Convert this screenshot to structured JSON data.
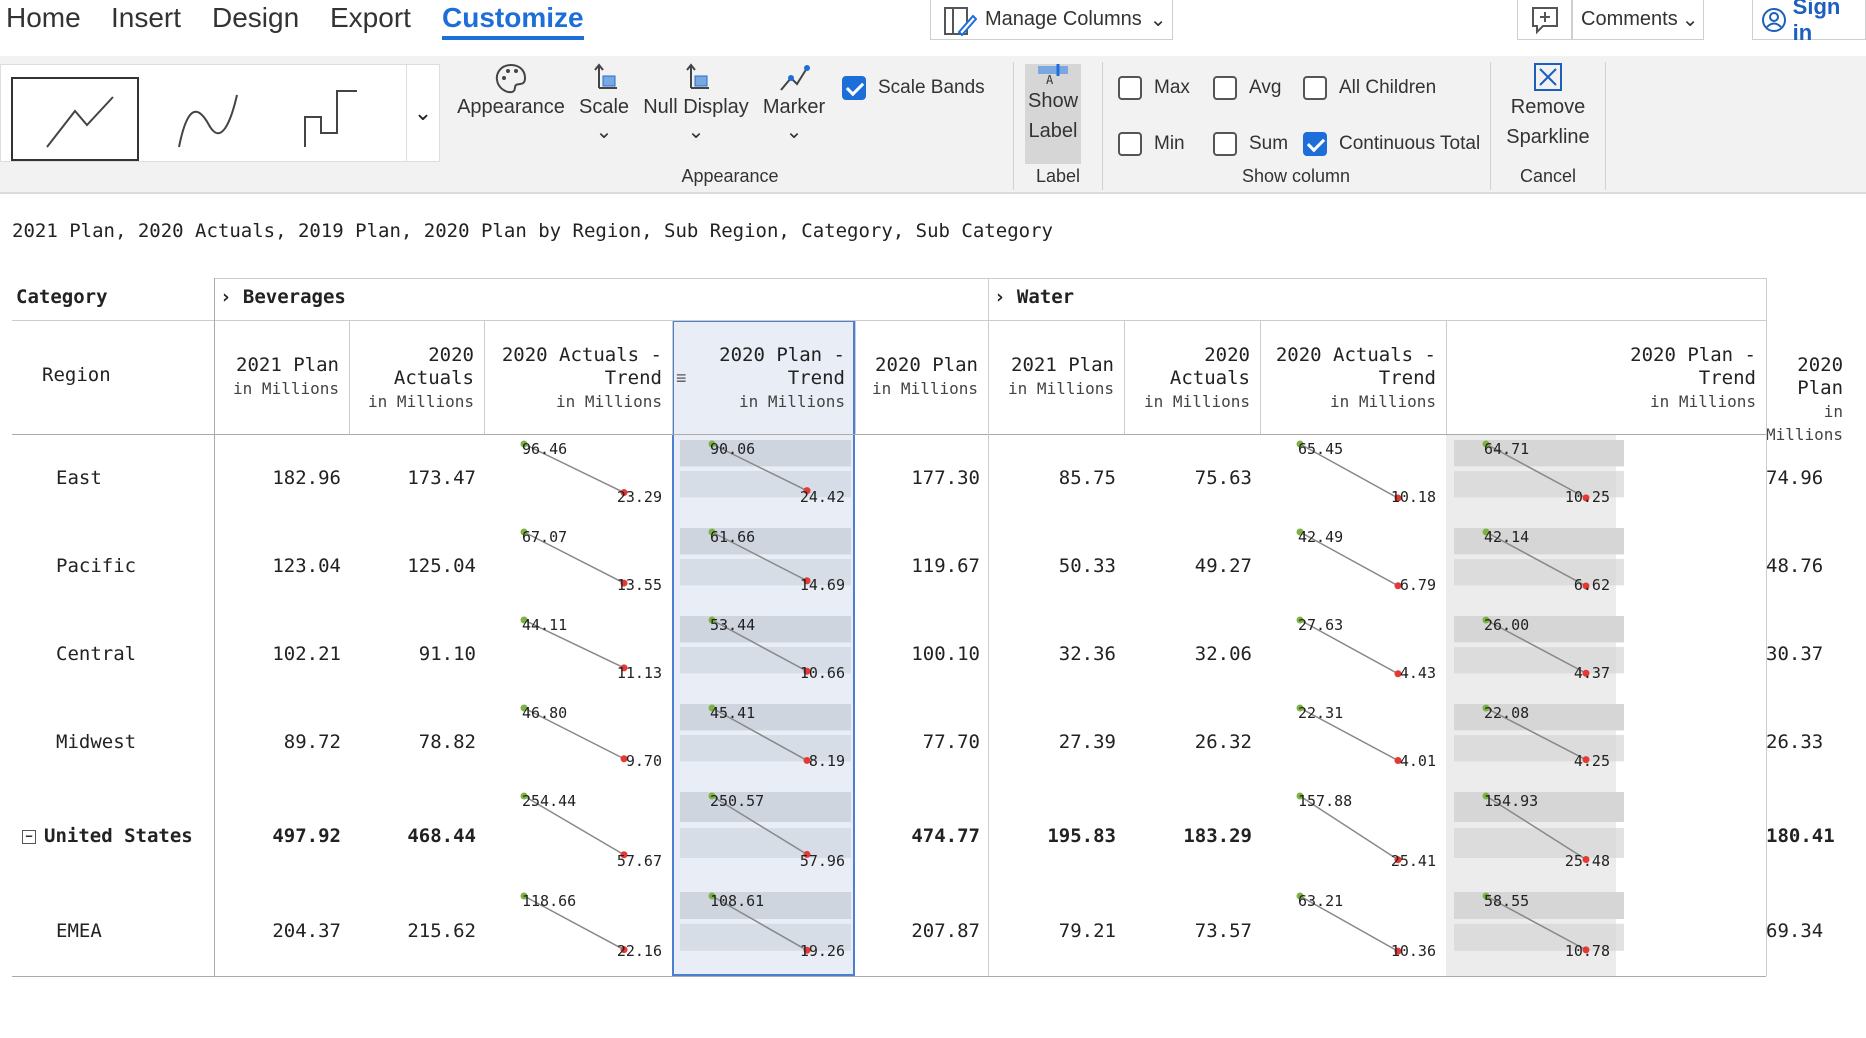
{
  "menu": {
    "items": [
      "Home",
      "Insert",
      "Design",
      "Export",
      "Customize"
    ],
    "active": "Customize",
    "manage_columns": "Manage Columns",
    "comments": "Comments",
    "sign_in": "Sign in"
  },
  "ribbon": {
    "appearance_btn": "Appearance",
    "scale_btn": "Scale",
    "null_display_btn": "Null Display",
    "marker_btn": "Marker",
    "scale_bands": "Scale Bands",
    "appearance_group": "Appearance",
    "show_label_line1": "Show",
    "show_label_line2": "Label",
    "label_group": "Label",
    "max": "Max",
    "avg": "Avg",
    "all_children": "All Children",
    "min": "Min",
    "sum": "Sum",
    "continuous_total": "Continuous Total",
    "show_column_group": "Show column",
    "remove_line1": "Remove",
    "remove_line2": "Sparkline",
    "cancel_group": "Cancel",
    "icons": [
      "line-chart-icon",
      "curve-chart-icon",
      "step-chart-icon",
      "palette-icon",
      "scale-icon",
      "null-display-icon",
      "marker-icon",
      "label-icon",
      "remove-icon"
    ]
  },
  "title": "2021 Plan, 2020 Actuals, 2019 Plan, 2020 Plan by Region, Sub Region, Category, Sub Category",
  "table": {
    "category_label": "Category",
    "region_label": "Region",
    "groups": [
      "Beverages",
      "Water"
    ],
    "col_headers": [
      {
        "l1": "",
        "l2": "2021 Plan",
        "sub": "in Millions"
      },
      {
        "l1": "2020",
        "l2": "Actuals",
        "sub": "in Millions"
      },
      {
        "l1": "2020 Actuals -",
        "l2": "Trend",
        "sub": "in Millions"
      },
      {
        "l1": "2020 Plan -",
        "l2": "Trend",
        "sub": "in Millions"
      },
      {
        "l1": "",
        "l2": "2020 Plan",
        "sub": "in Millions"
      }
    ],
    "rows": [
      {
        "region": "East",
        "bold": false,
        "bev": [
          "182.96",
          "173.47",
          [
            "96.46",
            "23.29"
          ],
          [
            "90.06",
            "24.42"
          ],
          "177.30"
        ],
        "wat": [
          "85.75",
          "75.63",
          [
            "65.45",
            "10.18"
          ],
          [
            "64.71",
            "10.25"
          ],
          "74.96"
        ]
      },
      {
        "region": "Pacific",
        "bold": false,
        "bev": [
          "123.04",
          "125.04",
          [
            "67.07",
            "13.55"
          ],
          [
            "61.66",
            "14.69"
          ],
          "119.67"
        ],
        "wat": [
          "50.33",
          "49.27",
          [
            "42.49",
            "6.79"
          ],
          [
            "42.14",
            "6.62"
          ],
          "48.76"
        ]
      },
      {
        "region": "Central",
        "bold": false,
        "bev": [
          "102.21",
          "91.10",
          [
            "44.11",
            "11.13"
          ],
          [
            "53.44",
            "10.66"
          ],
          "100.10"
        ],
        "wat": [
          "32.36",
          "32.06",
          [
            "27.63",
            "4.43"
          ],
          [
            "26.00",
            "4.37"
          ],
          "30.37"
        ]
      },
      {
        "region": "Midwest",
        "bold": false,
        "bev": [
          "89.72",
          "78.82",
          [
            "46.80",
            "9.70"
          ],
          [
            "45.41",
            "8.19"
          ],
          "77.70"
        ],
        "wat": [
          "27.39",
          "26.32",
          [
            "22.31",
            "4.01"
          ],
          [
            "22.08",
            "4.25"
          ],
          "26.33"
        ]
      },
      {
        "region": "United States",
        "bold": true,
        "bev": [
          "497.92",
          "468.44",
          [
            "254.44",
            "57.67"
          ],
          [
            "250.57",
            "57.96"
          ],
          "474.77"
        ],
        "wat": [
          "195.83",
          "183.29",
          [
            "157.88",
            "25.41"
          ],
          [
            "154.93",
            "25.48"
          ],
          "180.41"
        ]
      },
      {
        "region": "EMEA",
        "bold": false,
        "bev": [
          "204.37",
          "215.62",
          [
            "118.66",
            "22.16"
          ],
          [
            "108.61",
            "19.26"
          ],
          "207.87"
        ],
        "wat": [
          "79.21",
          "73.57",
          [
            "63.21",
            "10.36"
          ],
          [
            "58.55",
            "10.78"
          ],
          "69.34"
        ]
      }
    ],
    "colors": {
      "accent": "#1d6ed8",
      "start_marker": "#7cb342",
      "end_marker": "#e53935",
      "band_selected": "#e8edf6",
      "band_gray": "#e4e4e4"
    }
  }
}
